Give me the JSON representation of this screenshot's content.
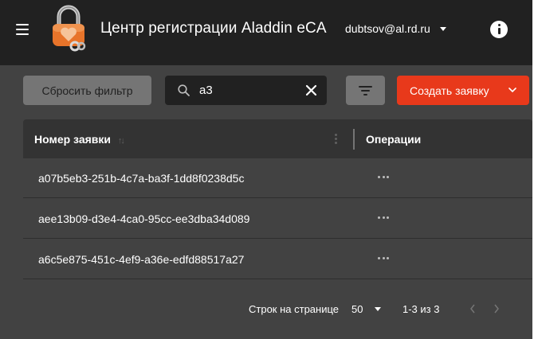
{
  "header": {
    "title": "Центр регистрации Aladdin eCA",
    "user": "dubtsov@al.rd.ru",
    "icons": {
      "menu": "menu-icon",
      "logo": "padlock-heart-logo",
      "info": "info-icon"
    }
  },
  "toolbar": {
    "reset_label": "Сбросить фильтр",
    "search_value": "а3",
    "create_label": "Создать заявку",
    "icons": {
      "search": "search-icon",
      "clear": "close-icon",
      "filter": "filter-icon",
      "create_menu": "chevron-down-icon"
    }
  },
  "table": {
    "columns": [
      "Номер заявки",
      "Операции"
    ],
    "sort_indicator": "↑↓",
    "rows": [
      {
        "id": "a07b5eb3-251b-4c7a-ba3f-1dd8f0238d5c",
        "ops": "•••"
      },
      {
        "id": "aee13b09-d3e4-4ca0-95cc-ee3dba34d089",
        "ops": "•••"
      },
      {
        "id": "a6c5e875-451c-4ef9-a36e-edfd88517a27",
        "ops": "•••"
      }
    ]
  },
  "pagination": {
    "rows_per_page_label": "Строк на странице",
    "rows_per_page": "50",
    "range": "1-3 из 3"
  },
  "colors": {
    "header_bg": "#212121",
    "surface": "#424242",
    "table_header": "#333333",
    "accent": "#e8391b",
    "button_gray": "#757575",
    "logo_orange": "#e8742a"
  }
}
